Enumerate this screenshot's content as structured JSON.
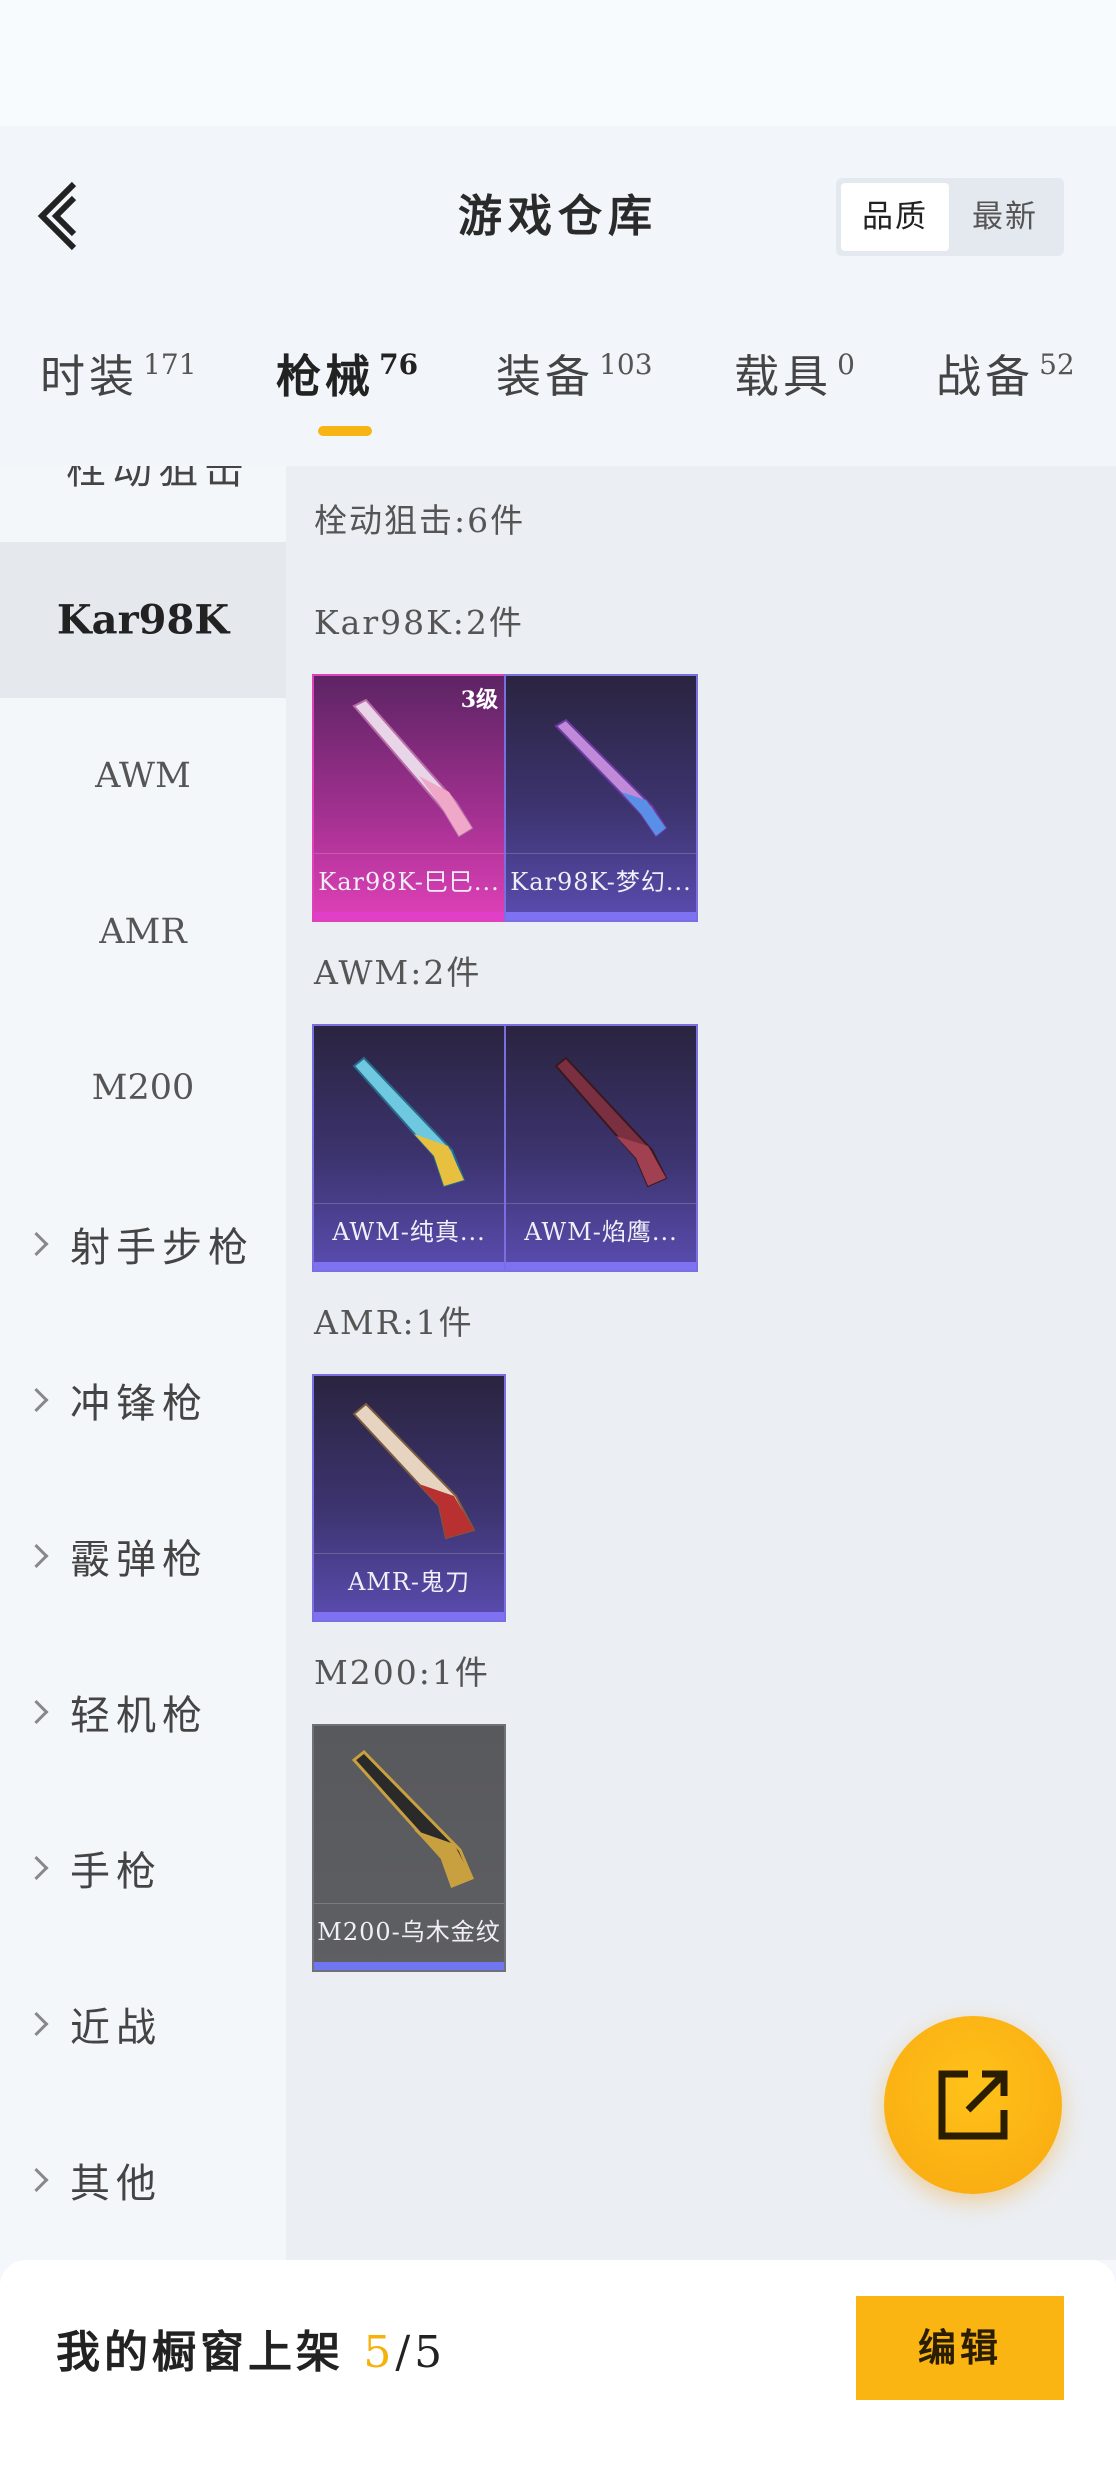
{
  "header": {
    "title": "游戏仓库",
    "sort_options": [
      "品质",
      "最新"
    ],
    "tabs": [
      {
        "label": "时装",
        "count": "171"
      },
      {
        "label": "枪械",
        "count": "76"
      },
      {
        "label": "装备",
        "count": "103"
      },
      {
        "label": "载具",
        "count": "0"
      },
      {
        "label": "战备",
        "count": "52"
      }
    ]
  },
  "sidebar": {
    "partial_top": "栓动狙击",
    "items": [
      {
        "label": "Kar98K",
        "kind": "sub",
        "selected": true
      },
      {
        "label": "AWM",
        "kind": "sub"
      },
      {
        "label": "AMR",
        "kind": "sub"
      },
      {
        "label": "M200",
        "kind": "sub"
      },
      {
        "label": "射手步枪",
        "kind": "category"
      },
      {
        "label": "冲锋枪",
        "kind": "category"
      },
      {
        "label": "霰弹枪",
        "kind": "category"
      },
      {
        "label": "轻机枪",
        "kind": "category"
      },
      {
        "label": "手枪",
        "kind": "category"
      },
      {
        "label": "近战",
        "kind": "category"
      },
      {
        "label": "其他",
        "kind": "category"
      }
    ]
  },
  "content": {
    "group_header": "栓动狙击:6件",
    "sections": [
      {
        "title": "Kar98K:2件",
        "items": [
          {
            "name": "Kar98K-巳巳...",
            "level": "3级",
            "rarity": "pink"
          },
          {
            "name": "Kar98K-梦幻...",
            "rarity": "purple"
          }
        ]
      },
      {
        "title": "AWM:2件",
        "items": [
          {
            "name": "AWM-纯真...",
            "rarity": "purple"
          },
          {
            "name": "AWM-焰鹰...",
            "rarity": "purple"
          }
        ]
      },
      {
        "title": "AMR:1件",
        "items": [
          {
            "name": "AMR-鬼刀",
            "rarity": "purple"
          }
        ]
      },
      {
        "title": "M200:1件",
        "items": [
          {
            "name": "M200-乌木金纹",
            "rarity": "grey"
          }
        ]
      }
    ]
  },
  "fab": {
    "icon": "share-external-icon"
  },
  "footer": {
    "shelf_label": "我的橱窗上架",
    "shelf_current": "5",
    "shelf_total": "/5",
    "edit_label": "编辑"
  },
  "colors": {
    "accent": "#fbb512",
    "rarity_pink": "#e040b8",
    "rarity_purple": "#7f72f2"
  }
}
